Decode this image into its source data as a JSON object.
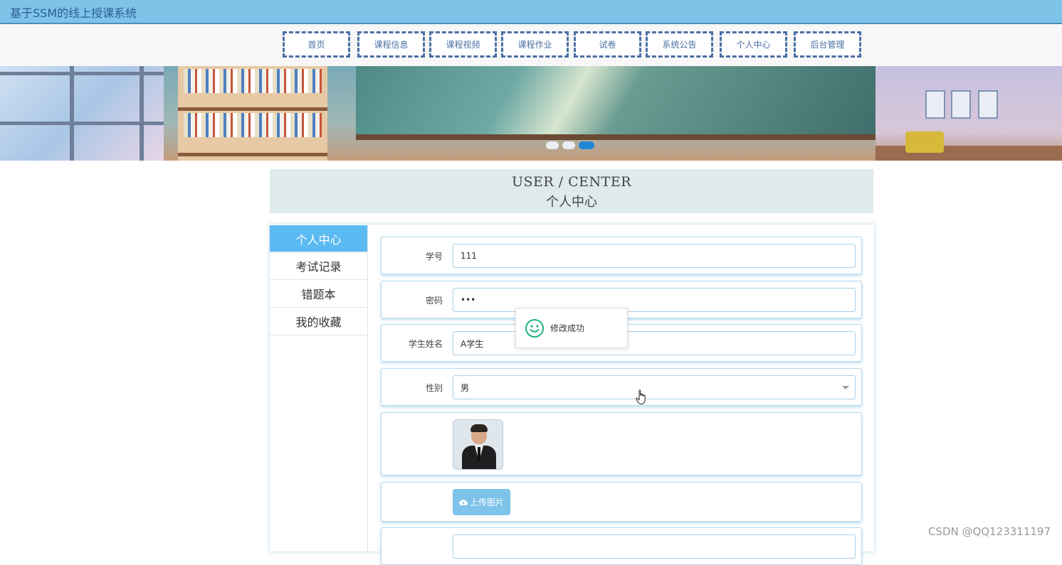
{
  "header": {
    "title": "基于SSM的线上授课系统"
  },
  "nav": {
    "items": [
      {
        "label": "首页"
      },
      {
        "label": "课程信息"
      },
      {
        "label": "课程视频"
      },
      {
        "label": "课程作业"
      },
      {
        "label": "试卷"
      },
      {
        "label": "系统公告"
      },
      {
        "label": "个人中心"
      },
      {
        "label": "后台管理"
      }
    ]
  },
  "banner": {
    "slide_count": 3,
    "active_slide": 3
  },
  "center_heading": {
    "en": "USER / CENTER",
    "cn": "个人中心"
  },
  "sidebar": {
    "items": [
      {
        "label": "个人中心",
        "active": true
      },
      {
        "label": "考试记录",
        "active": false
      },
      {
        "label": "错题本",
        "active": false
      },
      {
        "label": "我的收藏",
        "active": false
      }
    ]
  },
  "form": {
    "student_id": {
      "label": "学号",
      "value": "111"
    },
    "password": {
      "label": "密码",
      "value": "•••"
    },
    "student_name": {
      "label": "学生姓名",
      "value": "A学生"
    },
    "gender": {
      "label": "性别",
      "value": "男"
    },
    "upload_label": "上传图片"
  },
  "toast": {
    "message": "修改成功"
  },
  "watermark": "CSDN @QQ123311197",
  "colors": {
    "accent": "#5bbaf2",
    "topbar": "#7fc4e8",
    "nav_border": "#4a6fa5",
    "success_icon": "#1fb37e"
  }
}
